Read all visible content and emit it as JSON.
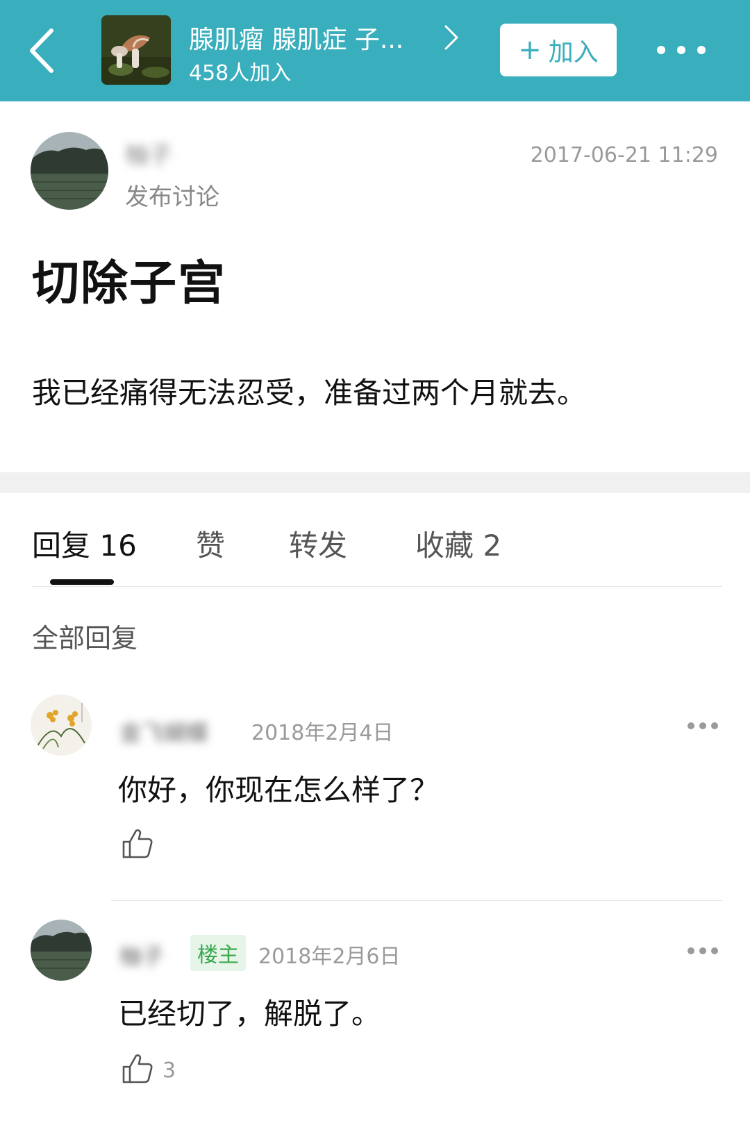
{
  "header": {
    "group_name": "腺肌瘤 腺肌症 子...",
    "member_count": "458人加入",
    "join_label": "加入",
    "join_plus": "+",
    "accent_color": "#39aebc"
  },
  "post": {
    "author_name": "柚子",
    "action": "发布讨论",
    "timestamp": "2017-06-21 11:29",
    "title": "切除子宫",
    "body": "我已经痛得无法忍受，准备过两个月就去。"
  },
  "tabs": [
    {
      "label": "回复 16"
    },
    {
      "label": "赞"
    },
    {
      "label": "转发"
    },
    {
      "label": "收藏 2"
    }
  ],
  "replies_header": "全部回复",
  "comments": [
    {
      "author": "金飞蝴蝶",
      "date": "2018年2月4日",
      "text": "你好，你现在怎么样了？",
      "likes": ""
    },
    {
      "author": "柚子",
      "badge": "楼主",
      "date": "2018年2月6日",
      "text": "已经切了，解脱了。",
      "likes": "3"
    }
  ]
}
